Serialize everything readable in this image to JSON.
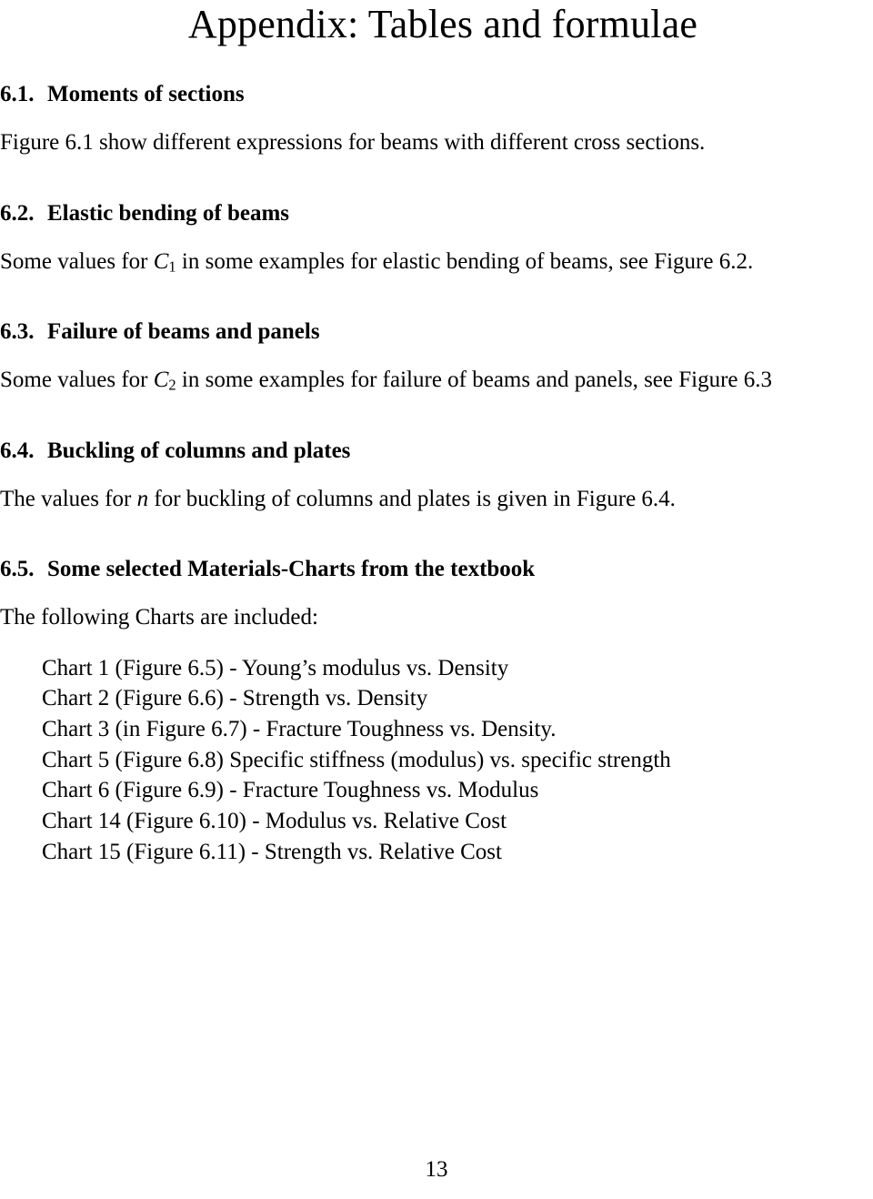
{
  "document": {
    "title": "Appendix: Tables and formulae",
    "page_number": "13"
  },
  "sections": [
    {
      "number": "6.1.",
      "heading": "Moments of sections",
      "body_prefix": "Figure 6.1 show different expressions for beams with different cross sections.",
      "math": "",
      "body_suffix": ""
    },
    {
      "number": "6.2.",
      "heading": "Elastic bending of beams",
      "body_prefix": "Some values for ",
      "math": "C",
      "math_sub": "1",
      "body_suffix": " in some examples for elastic bending of beams, see Figure 6.2."
    },
    {
      "number": "6.3.",
      "heading": "Failure of beams and panels",
      "body_prefix": "Some values for ",
      "math": "C",
      "math_sub": "2",
      "body_suffix": " in some examples for failure of beams and panels, see Figure 6.3"
    },
    {
      "number": "6.4.",
      "heading": "Buckling of columns and plates",
      "body_prefix": "The values for ",
      "math": "n",
      "math_sub": "",
      "body_suffix": " for buckling of columns and plates is given in Figure 6.4."
    },
    {
      "number": "6.5.",
      "heading": "Some selected Materials-Charts from the textbook",
      "body_prefix": "The following Charts are included:",
      "math": "",
      "body_suffix": ""
    }
  ],
  "chart_list": [
    "Chart 1 (Figure 6.5) - Young’s modulus vs. Density",
    "Chart 2 (Figure 6.6) - Strength vs. Density",
    "Chart 3 (in Figure 6.7) - Fracture Toughness vs. Density.",
    "Chart 5 (Figure 6.8) Specific stiffness (modulus) vs. specific strength",
    "Chart 6 (Figure 6.9) - Fracture Toughness vs. Modulus",
    "Chart 14 (Figure 6.10) - Modulus vs. Relative Cost",
    "Chart 15 (Figure 6.11) - Strength vs. Relative Cost"
  ]
}
